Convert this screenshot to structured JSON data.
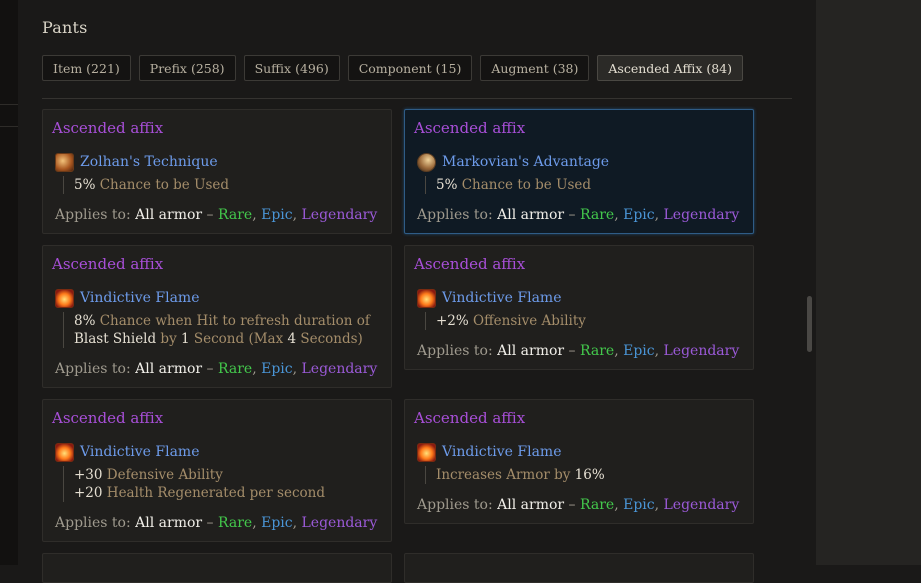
{
  "page": {
    "title": "Pants"
  },
  "tabs": [
    {
      "label": "Item (221)"
    },
    {
      "label": "Prefix (258)"
    },
    {
      "label": "Suffix (496)"
    },
    {
      "label": "Component (15)"
    },
    {
      "label": "Augment (38)"
    },
    {
      "label": "Ascended Affix (84)",
      "active": true
    }
  ],
  "applies": {
    "prefix": "Applies to: ",
    "armor": "All armor",
    "dash": " – ",
    "rare": "Rare",
    "comma": ", ",
    "epic": "Epic",
    "legendary": "Legendary"
  },
  "cards": [
    {
      "title": "Ascended affix",
      "icon": "scroll-icon",
      "name": "Zolhan's Technique",
      "lines": [
        [
          {
            "v": "5%"
          },
          {
            "t": " Chance to be Used"
          }
        ]
      ]
    },
    {
      "title": "Ascended affix",
      "icon": "wing-icon",
      "name": "Markovian's Advantage",
      "lines": [
        [
          {
            "v": "5%"
          },
          {
            "t": " Chance to be Used"
          }
        ]
      ]
    },
    {
      "title": "Ascended affix",
      "icon": "flame-icon",
      "name": "Vindictive Flame",
      "lines": [
        [
          {
            "v": "8%"
          },
          {
            "t": " Chance when Hit to refresh duration of"
          }
        ],
        [
          {
            "v": "Blast Shield"
          },
          {
            "t": " by "
          },
          {
            "v": "1"
          },
          {
            "t": " Second (Max "
          },
          {
            "v": "4"
          },
          {
            "t": " Seconds)"
          }
        ]
      ]
    },
    {
      "title": "Ascended affix",
      "icon": "flame-icon",
      "name": "Vindictive Flame",
      "lines": [
        [
          {
            "v": "+2%"
          },
          {
            "t": " Offensive Ability"
          }
        ]
      ]
    },
    {
      "title": "Ascended affix",
      "icon": "flame-icon",
      "name": "Vindictive Flame",
      "lines": [
        [
          {
            "v": "+30"
          },
          {
            "t": " Defensive Ability"
          }
        ],
        [
          {
            "v": "+20"
          },
          {
            "t": " Health Regenerated per second"
          }
        ]
      ]
    },
    {
      "title": "Ascended affix",
      "icon": "flame-icon",
      "name": "Vindictive Flame",
      "lines": [
        [
          {
            "t": "Increases Armor by "
          },
          {
            "v": "16%"
          }
        ]
      ]
    }
  ]
}
